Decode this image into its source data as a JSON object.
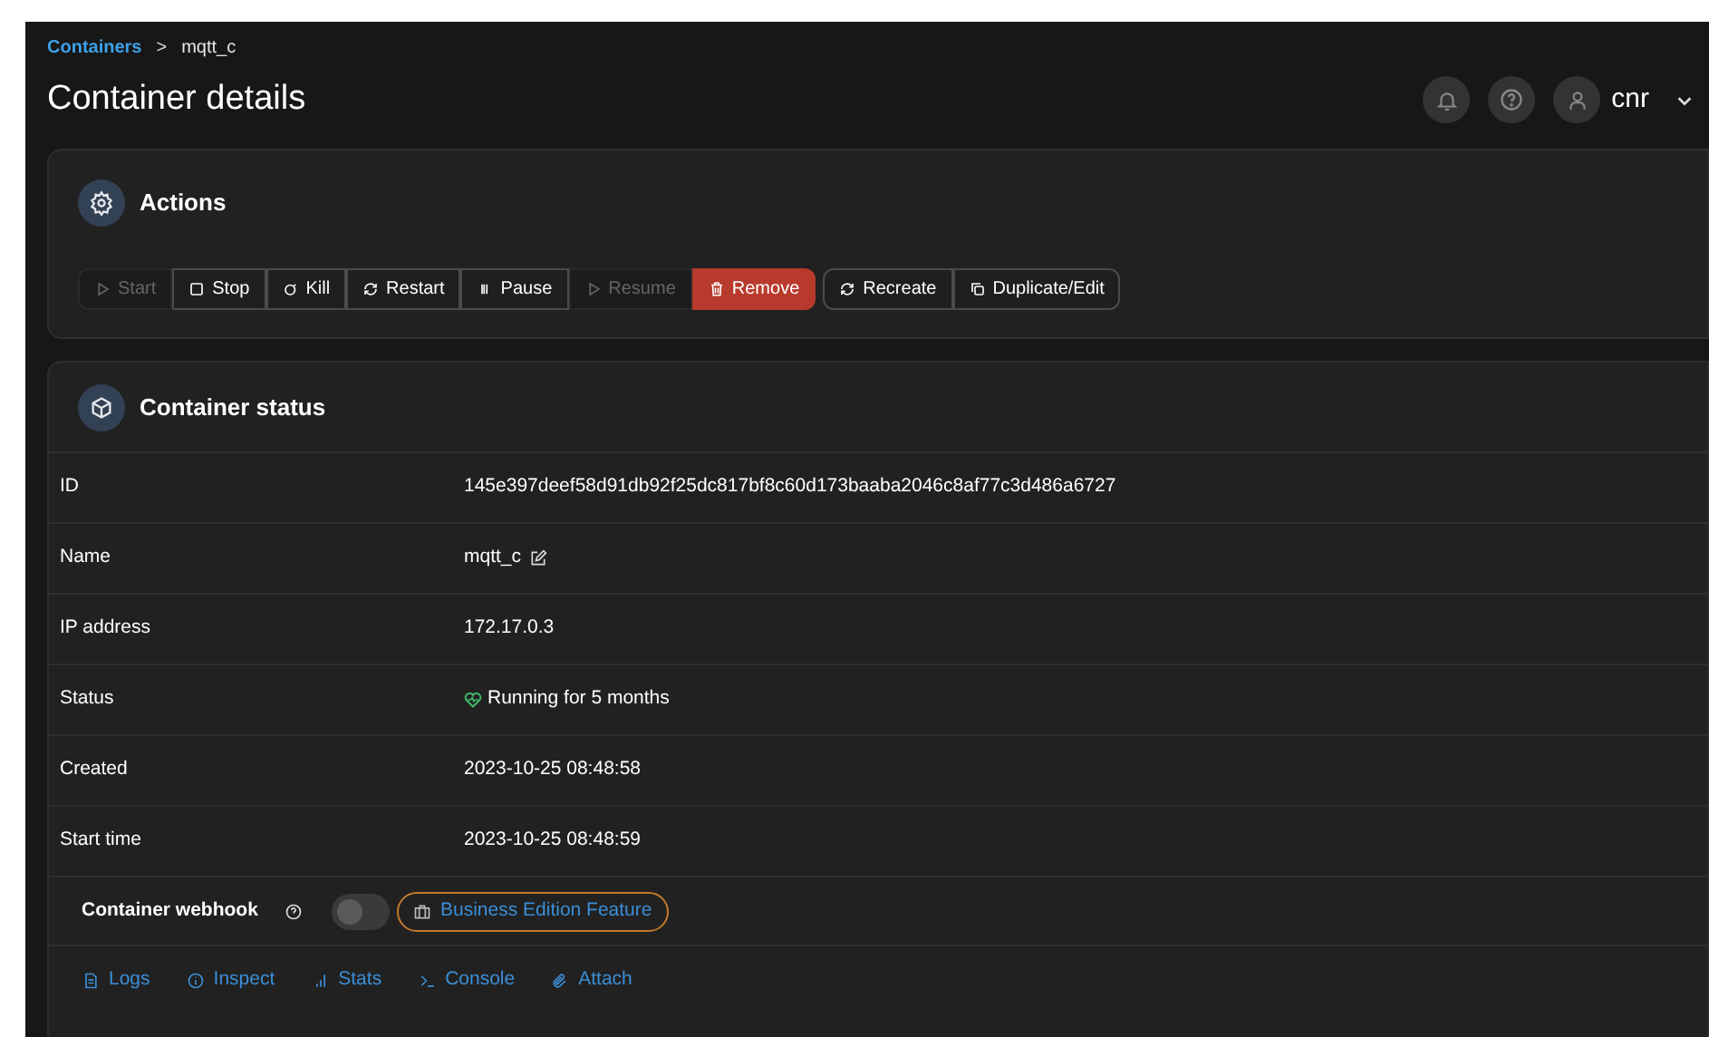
{
  "breadcrumb": {
    "link": "Containers",
    "separator": ">",
    "current": "mqtt_c"
  },
  "title": "Container details",
  "user": {
    "name": "cnr"
  },
  "actions": {
    "title": "Actions",
    "groups": [
      [
        {
          "label": "Start",
          "kind": "play",
          "disabled": true
        },
        {
          "label": "Stop",
          "kind": "stop",
          "disabled": false
        },
        {
          "label": "Kill",
          "kind": "kill",
          "disabled": false
        },
        {
          "label": "Restart",
          "kind": "restart",
          "disabled": false
        },
        {
          "label": "Pause",
          "kind": "pause",
          "disabled": false
        },
        {
          "label": "Resume",
          "kind": "play",
          "disabled": true
        },
        {
          "label": "Remove",
          "kind": "remove",
          "disabled": false
        }
      ],
      [
        {
          "label": "Recreate",
          "kind": "restart",
          "disabled": false
        },
        {
          "label": "Duplicate/Edit",
          "kind": "duplicate",
          "disabled": false
        }
      ]
    ]
  },
  "status": {
    "title": "Container status",
    "rows": [
      {
        "label": "ID",
        "value": "145e397deef58d91db92f25dc817bf8c60d173baaba2046c8af77c3d486a6727",
        "kind": "text"
      },
      {
        "label": "Name",
        "value": "mqtt_c",
        "kind": "editable"
      },
      {
        "label": "IP address",
        "value": "172.17.0.3",
        "kind": "text"
      },
      {
        "label": "Status",
        "value": "Running for 5 months",
        "kind": "health"
      },
      {
        "label": "Created",
        "value": "2023-10-25 08:48:58",
        "kind": "text"
      },
      {
        "label": "Start time",
        "value": "2023-10-25 08:48:59",
        "kind": "text"
      }
    ],
    "webhook": {
      "label": "Container webhook",
      "on": false,
      "badge": "Business Edition Feature"
    },
    "links": [
      {
        "label": "Logs",
        "kind": "logs"
      },
      {
        "label": "Inspect",
        "kind": "inspect"
      },
      {
        "label": "Stats",
        "kind": "stats"
      },
      {
        "label": "Console",
        "kind": "console"
      },
      {
        "label": "Attach",
        "kind": "attach"
      }
    ]
  }
}
